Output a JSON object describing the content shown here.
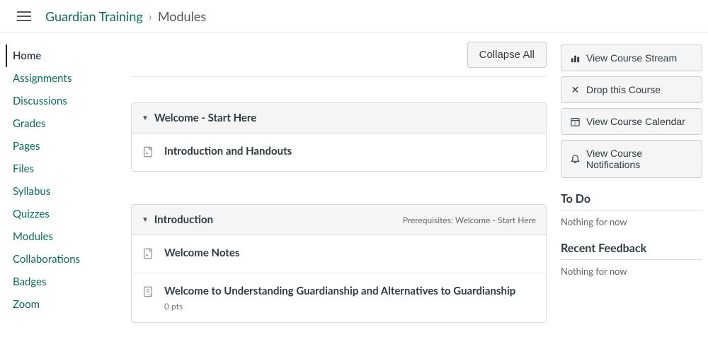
{
  "breadcrumb": {
    "course": "Guardian Training",
    "current": "Modules"
  },
  "sidebar": {
    "items": [
      {
        "label": "Home",
        "active": true
      },
      {
        "label": "Assignments"
      },
      {
        "label": "Discussions"
      },
      {
        "label": "Grades"
      },
      {
        "label": "Pages"
      },
      {
        "label": "Files"
      },
      {
        "label": "Syllabus"
      },
      {
        "label": "Quizzes"
      },
      {
        "label": "Modules"
      },
      {
        "label": "Collaborations"
      },
      {
        "label": "Badges"
      },
      {
        "label": "Zoom"
      }
    ]
  },
  "topbar": {
    "collapse_all": "Collapse All"
  },
  "modules": [
    {
      "title": "Welcome - Start Here",
      "prerequisites": "",
      "items": [
        {
          "title": "Introduction and Handouts",
          "icon": "page-icon",
          "pts": ""
        }
      ]
    },
    {
      "title": "Introduction",
      "prerequisites": "Prerequisites: Welcome - Start Here",
      "items": [
        {
          "title": "Welcome Notes",
          "icon": "page-icon",
          "pts": ""
        },
        {
          "title": "Welcome to Understanding Guardianship and Alternatives to Guardianship",
          "icon": "assignment-icon",
          "pts": "0 pts"
        }
      ]
    }
  ],
  "right": {
    "actions": {
      "stream": "View Course Stream",
      "drop": "Drop this Course",
      "calendar": "View Course Calendar",
      "notifications": "View Course Notifications"
    },
    "todo": {
      "title": "To Do",
      "empty": "Nothing for now"
    },
    "feedback": {
      "title": "Recent Feedback",
      "empty": "Nothing for now"
    }
  }
}
